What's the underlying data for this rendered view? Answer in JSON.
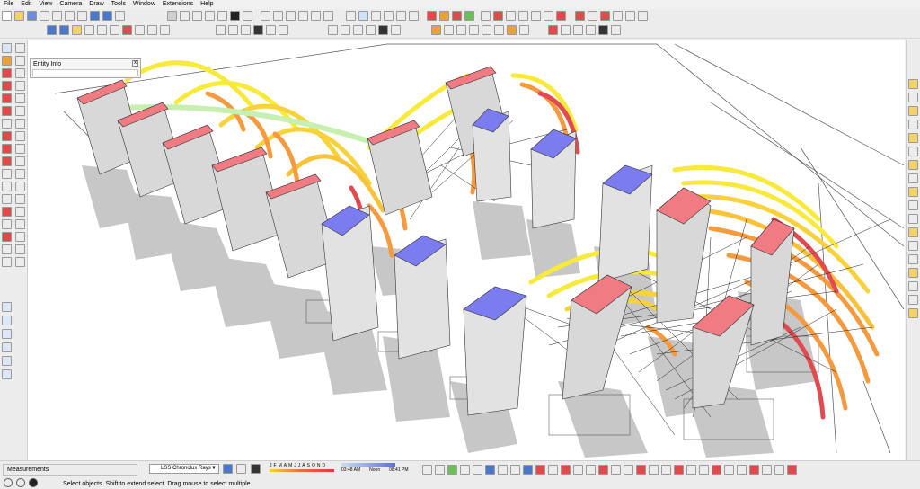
{
  "menu": [
    "File",
    "Edit",
    "View",
    "Camera",
    "Draw",
    "Tools",
    "Window",
    "Extensions",
    "Help"
  ],
  "entity_info": {
    "title": "Entity Info",
    "close": "x"
  },
  "status": {
    "measurements_label": "Measurements",
    "hint": "Select objects. Shift to extend select. Drag mouse to select multiple."
  },
  "lss": {
    "plugin_name": "LSS Chronolux Rays",
    "months": [
      "J",
      "F",
      "M",
      "A",
      "M",
      "J",
      "J",
      "A",
      "S",
      "O",
      "N",
      "D"
    ],
    "time_start": "03:48 AM",
    "time_noon": "Noon",
    "time_end": "08:41 PM"
  },
  "colors": {
    "roof_pink": "#f07b82",
    "roof_blue": "#7a7cf0",
    "building_fill": "#e2e2e2",
    "shadow": "#c7c7c7",
    "arc_yellow": "#f8ea3a",
    "arc_orange": "#f59a3f",
    "arc_red": "#e24a52"
  },
  "icons": {
    "toolbar": [
      "select-tool-icon",
      "eraser-icon",
      "paint-bucket-icon",
      "line-tool-icon",
      "rectangle-icon",
      "circle-icon",
      "arc-icon",
      "push-pull-icon",
      "move-icon",
      "rotate-icon",
      "scale-icon",
      "offset-icon",
      "tape-measure-icon",
      "text-icon",
      "axes-icon",
      "orbit-icon",
      "pan-icon",
      "zoom-icon",
      "zoom-extents-icon",
      "walk-icon",
      "section-plane-icon"
    ]
  }
}
